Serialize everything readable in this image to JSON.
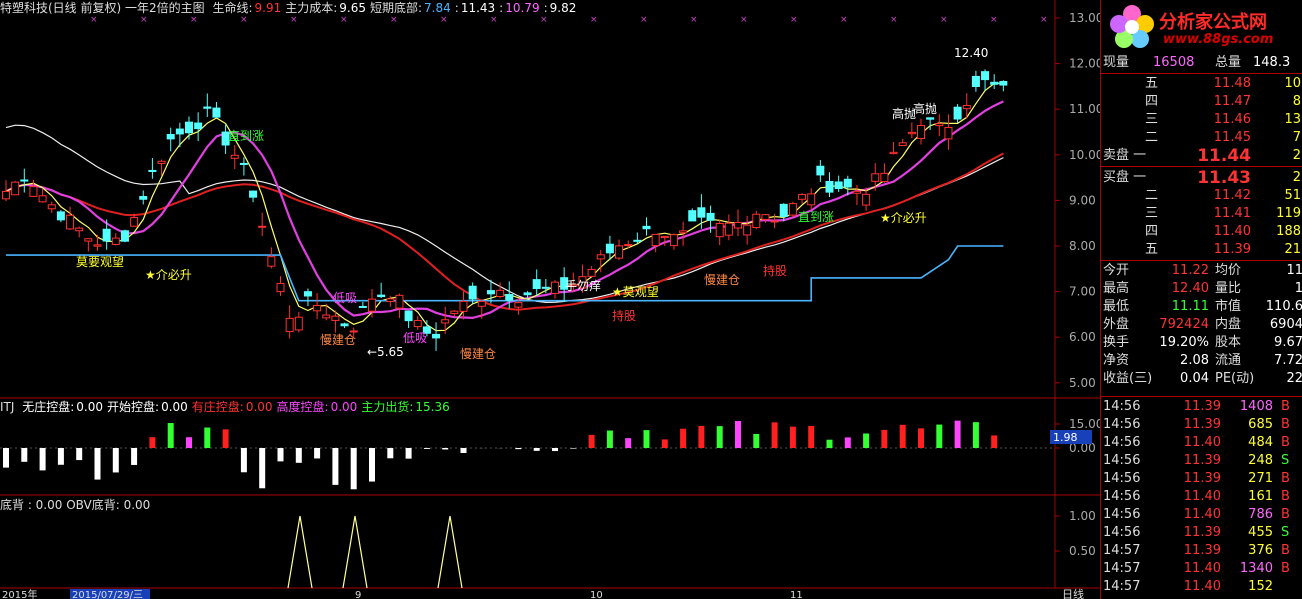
{
  "header": {
    "title": "特塑科技(日线 前复权) 一年2倍的主图",
    "items": [
      {
        "label": "生命线:",
        "value": "9.91",
        "color": "#ff3333"
      },
      {
        "label": "主力成本:",
        "value": "9.65",
        "color": "#ffffff"
      },
      {
        "label": "短期底部:",
        "value": "7.84",
        "color": "#4ab4ff"
      },
      {
        "label": ":",
        "value": "11.43",
        "color": "#ffffff"
      },
      {
        "label": ":",
        "value": "10.79",
        "color": "#ff66ff"
      },
      {
        "label": ":",
        "value": "9.82",
        "color": "#ffffff"
      }
    ]
  },
  "indicator1": {
    "name": "ITJ",
    "items": [
      {
        "label": "无庄控盘:",
        "value": "0.00",
        "color": "#ffffff"
      },
      {
        "label": "开始控盘:",
        "value": "0.00",
        "color": "#ffffff"
      },
      {
        "label": "有庄控盘:",
        "value": "0.00",
        "color": "#ff3333"
      },
      {
        "label": "高度控盘:",
        "value": "0.00",
        "color": "#ff44ff"
      },
      {
        "label": "主力出货:",
        "value": "15.36",
        "color": "#33ff33"
      }
    ],
    "current_value": "1.98"
  },
  "indicator2": {
    "label": "底背 : 0.00 OBV底背: 0.00"
  },
  "main_y_ticks": [
    "13.00",
    "12.00",
    "11.00",
    "10.00",
    "9.00",
    "8.00",
    "7.00",
    "6.00",
    "5.00"
  ],
  "ind1_y_ticks": [
    "15.00",
    "0.00"
  ],
  "ind2_y_ticks": [
    "1.00",
    "0.50"
  ],
  "x_axis": {
    "labels": [
      "2015年",
      "2015/07/29/三",
      "9",
      "10",
      "11"
    ],
    "period_tab": "日线"
  },
  "annotations": [
    {
      "text": "直到涨",
      "color": "#33ff33"
    },
    {
      "text": "★介必升",
      "color": "#ffff33"
    },
    {
      "text": "莫要观望",
      "color": "#ffff33"
    },
    {
      "text": "低吸",
      "color": "#ff44ff"
    },
    {
      "text": "低吸",
      "color": "#ff44ff"
    },
    {
      "text": "慢建仓",
      "color": "#ff8844"
    },
    {
      "text": "慢建仓",
      "color": "#ff8844"
    },
    {
      "text": "←5.65",
      "color": "#ffffff"
    },
    {
      "text": "手勿痒",
      "color": "#ffffff"
    },
    {
      "text": "★莫观望",
      "color": "#ffff33"
    },
    {
      "text": "持股",
      "color": "#ff3333"
    },
    {
      "text": "慢建仓",
      "color": "#ff8844"
    },
    {
      "text": "持股",
      "color": "#ff3333"
    },
    {
      "text": "直到涨",
      "color": "#33ff33"
    },
    {
      "text": "★介必升",
      "color": "#ffff33"
    },
    {
      "text": "高抛",
      "color": "#ffffff"
    },
    {
      "text": "高抛",
      "color": "#ffffff"
    },
    {
      "text": "12.40",
      "color": "#ffffff"
    }
  ],
  "right_panel": {
    "logo": {
      "text": "分析家公式网",
      "url": "www.88gs.com"
    },
    "top": [
      {
        "l1": "现量",
        "v1": "16508",
        "l2": "总量",
        "v2": "148.3"
      }
    ],
    "asks": [
      {
        "label": "五",
        "price": "11.48",
        "vol": "10"
      },
      {
        "label": "四",
        "price": "11.47",
        "vol": "8"
      },
      {
        "label": "三",
        "price": "11.46",
        "vol": "13"
      },
      {
        "label": "二",
        "price": "11.45",
        "vol": "7"
      },
      {
        "label": "卖盘 一",
        "price": "11.44",
        "vol": "2"
      }
    ],
    "bids": [
      {
        "label": "买盘 一",
        "price": "11.43",
        "vol": "2"
      },
      {
        "label": "二",
        "price": "11.42",
        "vol": "51"
      },
      {
        "label": "三",
        "price": "11.41",
        "vol": "119"
      },
      {
        "label": "四",
        "price": "11.40",
        "vol": "188"
      },
      {
        "label": "五",
        "price": "11.39",
        "vol": "21"
      }
    ],
    "stats": [
      {
        "l1": "今开",
        "v1": "11.22",
        "c1": "#ff3333",
        "l2": "均价",
        "v2": "11"
      },
      {
        "l1": "最高",
        "v1": "12.40",
        "c1": "#ff3333",
        "l2": "量比",
        "v2": "1"
      },
      {
        "l1": "最低",
        "v1": "11.11",
        "c1": "#33ff33",
        "l2": "市值",
        "v2": "110.6"
      },
      {
        "l1": "外盘",
        "v1": "792424",
        "c1": "#ff3333",
        "l2": "内盘",
        "v2": "6904"
      },
      {
        "l1": "换手",
        "v1": "19.20%",
        "c1": "#ffffff",
        "l2": "股本",
        "v2": "9.67"
      },
      {
        "l1": "净资",
        "v1": "2.08",
        "c1": "#ffffff",
        "l2": "流通",
        "v2": "7.72"
      },
      {
        "l1": "收益(三)",
        "v1": "0.04",
        "c1": "#ffffff",
        "l2": "PE(动)",
        "v2": "22"
      }
    ],
    "ticks": [
      {
        "time": "14:56",
        "price": "11.39",
        "vol": "1408",
        "side": "B"
      },
      {
        "time": "14:56",
        "price": "11.39",
        "vol": "685",
        "side": "B"
      },
      {
        "time": "14:56",
        "price": "11.40",
        "vol": "484",
        "side": "B"
      },
      {
        "time": "14:56",
        "price": "11.39",
        "vol": "248",
        "side": "S"
      },
      {
        "time": "14:56",
        "price": "11.39",
        "vol": "271",
        "side": "B"
      },
      {
        "time": "14:56",
        "price": "11.40",
        "vol": "161",
        "side": "B"
      },
      {
        "time": "14:56",
        "price": "11.40",
        "vol": "786",
        "side": "B"
      },
      {
        "time": "14:56",
        "price": "11.39",
        "vol": "455",
        "side": "S"
      },
      {
        "time": "14:57",
        "price": "11.39",
        "vol": "376",
        "side": "B"
      },
      {
        "time": "14:57",
        "price": "11.40",
        "vol": "1340",
        "side": "B"
      },
      {
        "time": "14:57",
        "price": "11.40",
        "vol": "152",
        "side": ""
      }
    ]
  }
}
